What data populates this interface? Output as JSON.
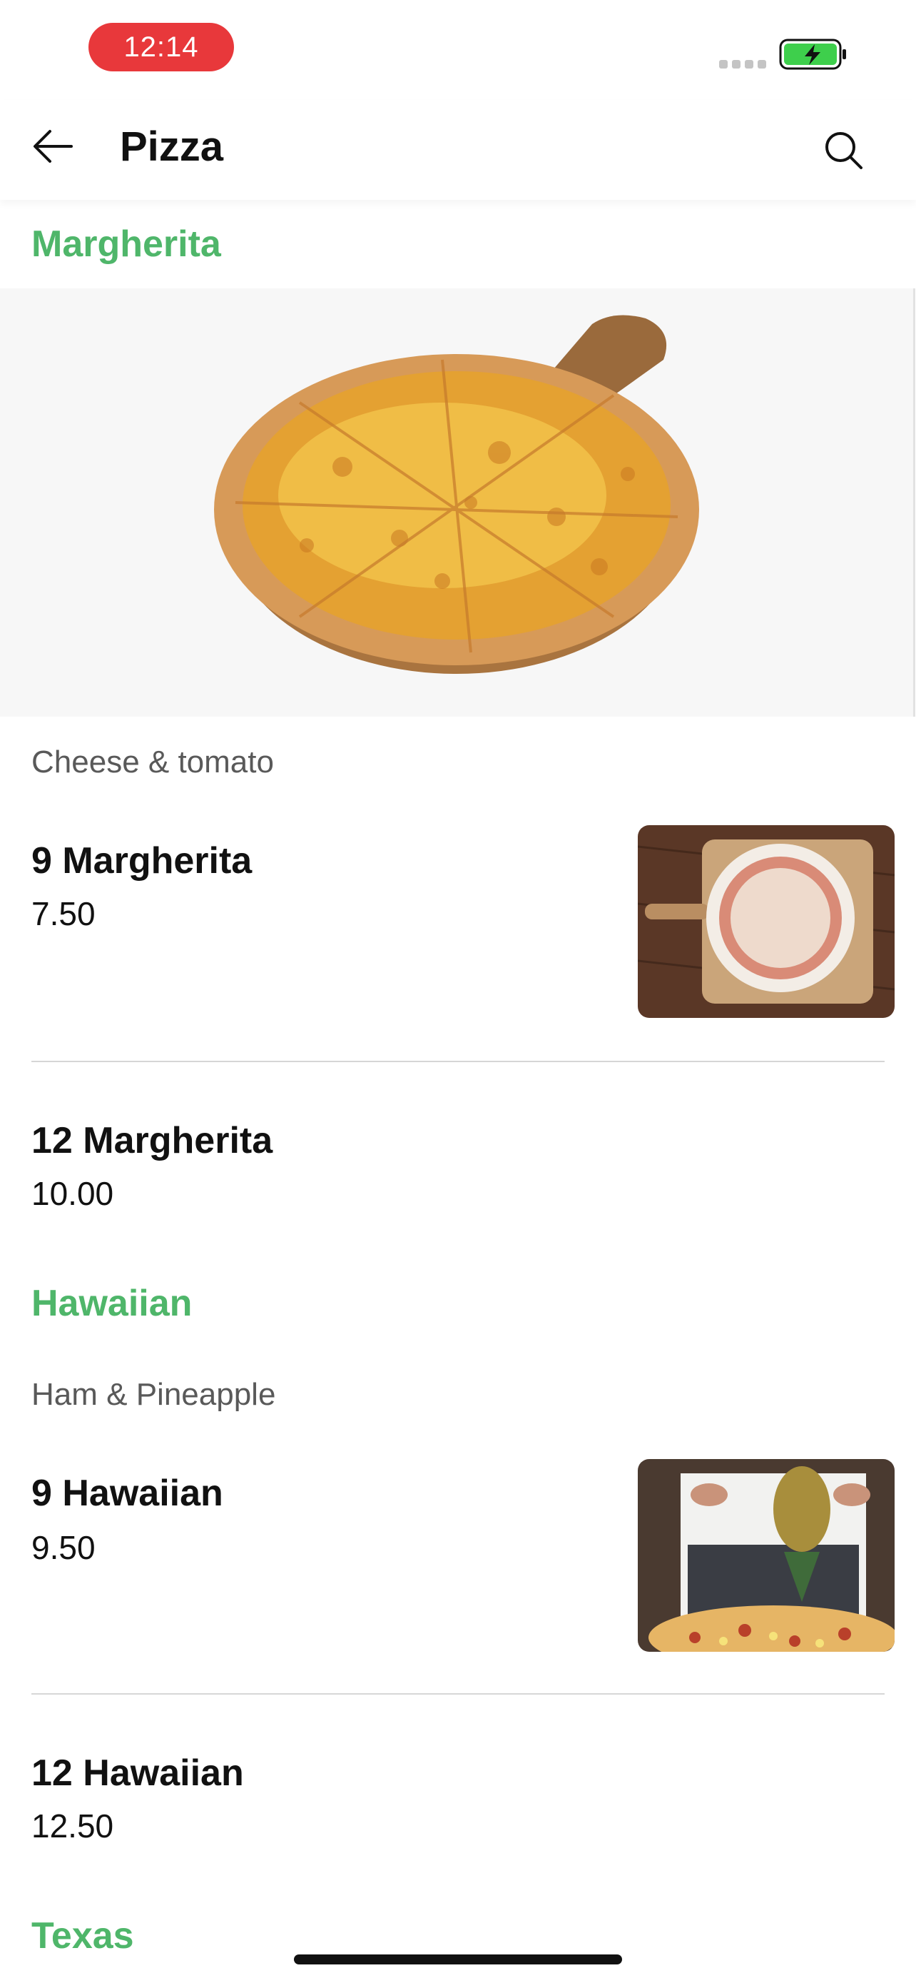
{
  "status": {
    "time": "12:14"
  },
  "header": {
    "title": "Pizza"
  },
  "sections": [
    {
      "title": "Margherita",
      "description": "Cheese & tomato",
      "items": [
        {
          "name": "9 Margherita",
          "price": "7.50"
        },
        {
          "name": "12 Margherita",
          "price": "10.00"
        }
      ]
    },
    {
      "title": "Hawaiian",
      "description": "Ham & Pineapple",
      "items": [
        {
          "name": "9 Hawaiian",
          "price": "9.50"
        },
        {
          "name": "12 Hawaiian",
          "price": "12.50"
        }
      ]
    },
    {
      "title": "Texas"
    }
  ],
  "colors": {
    "accent": "#4fb66a",
    "time_pill": "#e8383b",
    "battery": "#3ecf4c"
  }
}
